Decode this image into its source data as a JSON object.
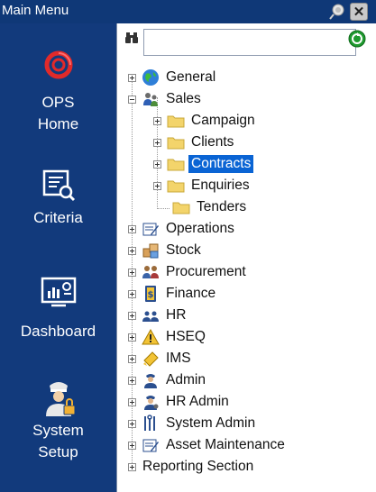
{
  "window": {
    "title": "Main Menu"
  },
  "nav": {
    "items": [
      {
        "label": "OPS\nHome",
        "icon": "ops-logo-icon"
      },
      {
        "label": "Criteria",
        "icon": "criteria-icon"
      },
      {
        "label": "Dashboard",
        "icon": "dashboard-icon"
      },
      {
        "label": "System\nSetup",
        "icon": "system-setup-icon"
      }
    ]
  },
  "search": {
    "value": "",
    "placeholder": ""
  },
  "tree": {
    "general": "General",
    "sales": "Sales",
    "campaign": "Campaign",
    "clients": "Clients",
    "contracts": "Contracts",
    "enquiries": "Enquiries",
    "tenders": "Tenders",
    "operations": "Operations",
    "stock": "Stock",
    "procurement": "Procurement",
    "finance": "Finance",
    "hr": "HR",
    "hseq": "HSEQ",
    "ims": "IMS",
    "admin": "Admin",
    "hr_admin": "HR Admin",
    "system_admin": "System Admin",
    "asset_maintenance": "Asset Maintenance",
    "reporting_section": "Reporting Section"
  },
  "colors": {
    "titlebar": "#0f3877",
    "nav_bg": "#123a7c",
    "selection": "#0a64d4"
  }
}
